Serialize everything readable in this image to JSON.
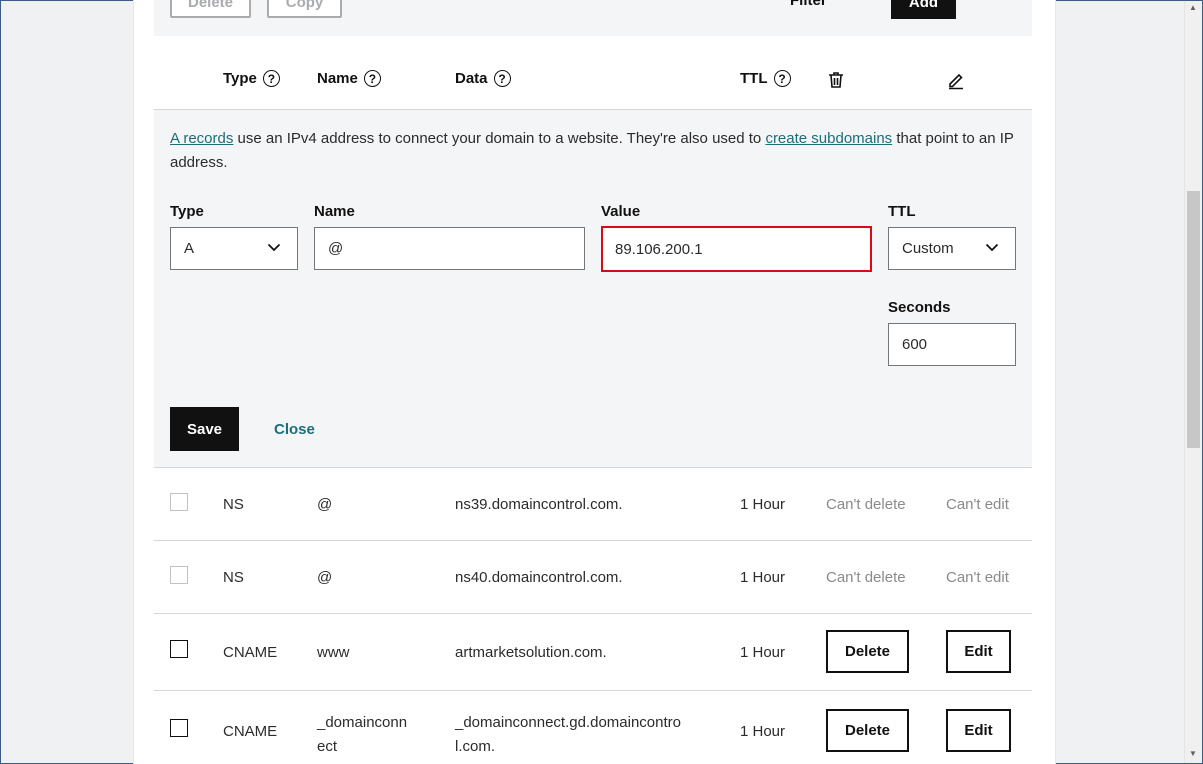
{
  "toolbar": {
    "delete_label": "Delete",
    "copy_label": "Copy",
    "filter_label": "Filter",
    "add_label": "Add"
  },
  "table_header": {
    "type": "Type",
    "name": "Name",
    "data": "Data",
    "ttl": "TTL",
    "help_glyph": "?"
  },
  "edit_panel": {
    "desc_link1": "A records",
    "desc_text1": " use an IPv4 address to connect your domain to a website. They're also used to ",
    "desc_link2": "create subdomains",
    "desc_text2": " that point to an IP address.",
    "type_label": "Type",
    "type_value": "A",
    "name_label": "Name",
    "name_value": "@",
    "value_label": "Value",
    "value_value": "89.106.200.1",
    "ttl_label": "TTL",
    "ttl_value": "Custom",
    "seconds_label": "Seconds",
    "seconds_value": "600",
    "save_label": "Save",
    "close_label": "Close"
  },
  "records": [
    {
      "type": "NS",
      "name": "@",
      "data": "ns39.domaincontrol.com.",
      "ttl": "1 Hour",
      "delete": "Can't delete",
      "edit": "Can't edit"
    },
    {
      "type": "NS",
      "name": "@",
      "data": "ns40.domaincontrol.com.",
      "ttl": "1 Hour",
      "delete": "Can't delete",
      "edit": "Can't edit"
    },
    {
      "type": "CNAME",
      "name": "www",
      "data": "artmarketsolution.com.",
      "ttl": "1 Hour",
      "delete": "Delete",
      "edit": "Edit"
    },
    {
      "type": "CNAME",
      "name_line1": "_domainconn",
      "name_line2": "ect",
      "data_line1": "_domainconnect.gd.domaincontro",
      "data_line2": "l.com.",
      "ttl": "1 Hour",
      "delete": "Delete",
      "edit": "Edit"
    }
  ],
  "colors": {
    "accent_link": "#1c6e77",
    "focus_border": "#d60b16",
    "primary_button": "#111111",
    "panel_bg": "#f4f5f6"
  }
}
